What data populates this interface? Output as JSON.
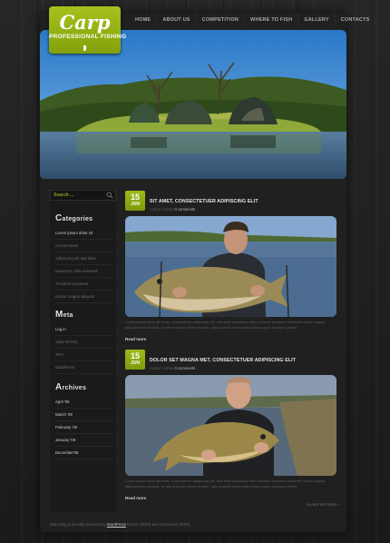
{
  "logo": {
    "script": "Carp",
    "subtitle": "PROFESSIONAL FISHING"
  },
  "nav": {
    "items": [
      "HOME",
      "ABOUT US",
      "COMPETITION",
      "WHERE TO FISH",
      "GALLERY",
      "CONTACTS"
    ]
  },
  "search": {
    "placeholder": "Search ..."
  },
  "sidebar": {
    "categories": {
      "title_first": "C",
      "title_rest": "ategories",
      "items": [
        "Lorem ipsum dolor sit",
        "Consectetuer",
        "Adipiscing elit sed diam",
        "Nonummy nibh euismod",
        "Tincidunt ut laoreet",
        "Dolore magna aliquam"
      ]
    },
    "meta": {
      "title_first": "M",
      "title_rest": "eta",
      "items": [
        "Log in",
        "Valid XHTML",
        "XFN",
        "WordPress"
      ]
    },
    "archives": {
      "title_first": "A",
      "title_rest": "rchives",
      "items": [
        "April '09",
        "March '09",
        "February '09",
        "January '09",
        "December'09"
      ]
    }
  },
  "posts": [
    {
      "day": "15",
      "month": "JUN",
      "title": "SIT AMET, CONSECTETUER ADIPISCING ELIT",
      "meta_prefix": "Author: Admin  ",
      "comments": "0 comments",
      "excerpt": "Lorem ipsum dolor sit amet, consectetuer adipiscing elit, sed diam nonummy nibh euismod tincidunt ut laoreet dolore magna aliquam erat volutpat. Ut wisi enim ad minim veniam, quis nostrud exerci tation ullamcorper suscipit lobortis.",
      "read_more": "Read more"
    },
    {
      "day": "15",
      "month": "JUN",
      "title": "DOLOR SET MAGNA MET, CONSECTETUER ADIPISCING ELIT",
      "meta_prefix": "Author: Admin  ",
      "comments": "0 comments",
      "excerpt": "Lorem ipsum dolor sit amet, consectetuer adipiscing elit, sed diam nonummy nibh euismod tincidunt ut laoreet dolore magna aliquam erat volutpat. Ut wisi enim ad minim veniam, quis nostrud exerci tation ullamcorper suscipit lobortis.",
      "read_more": "Read more"
    }
  ],
  "pagination": {
    "older": "OLDER ENTRIES »"
  },
  "footer": {
    "prefix": "Web Blog is proudly powered by ",
    "link1": "WordPress",
    "middle": " Entries (RSS) and Comments (RSS)"
  },
  "colors": {
    "accent": "#8fad12",
    "background": "#1b1b1b",
    "panel": "#202020"
  }
}
